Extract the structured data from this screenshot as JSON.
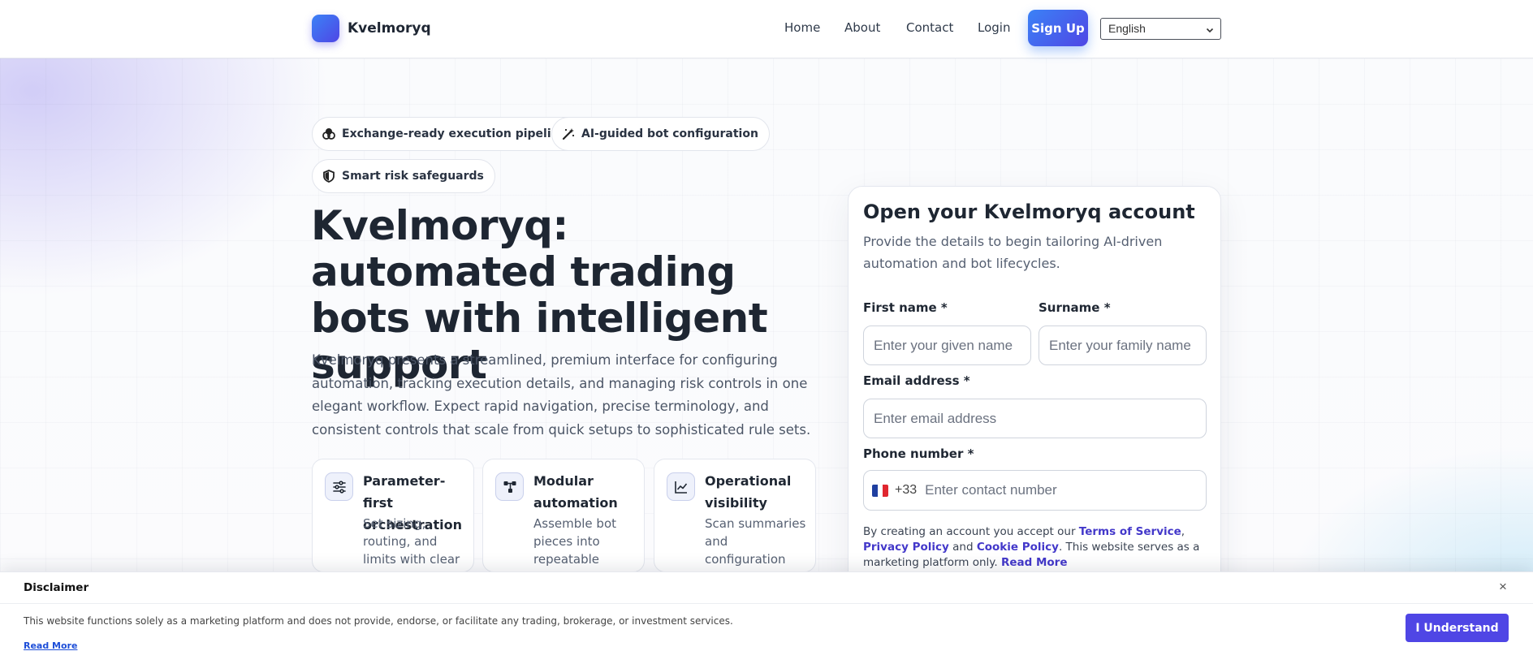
{
  "header": {
    "brand": "Kvelmoryq",
    "nav": [
      "Home",
      "About",
      "Contact",
      "Login"
    ],
    "signup_label": "Sign Up",
    "language": "English"
  },
  "hero": {
    "chips": [
      {
        "label": "Exchange-ready execution pipelines",
        "icon": "coins-icon"
      },
      {
        "label": "AI-guided bot configuration",
        "icon": "magic-wand-icon"
      },
      {
        "label": "Smart risk safeguards",
        "icon": "shield-icon"
      }
    ],
    "title": "Kvelmoryq: automated trading bots with intelligent support",
    "description": "Kvelmoryq presents a streamlined, premium interface for configuring automa­tion, tracking execution details, and managing risk controls in one elegant work­flow. Expect rapid navigation, precise terminology, and consistent controls that scale from quick setups to sophisticated rule sets.",
    "features": [
      {
        "title": "Parameter-first orchestration",
        "desc": "Set sizing, routing, and limits with clear",
        "icon": "sliders-icon"
      },
      {
        "title": "Modular automation",
        "desc": "Assemble bot pieces into repeatable",
        "icon": "nodes-icon"
      },
      {
        "title": "Operational visibility",
        "desc": "Scan summaries and configuration",
        "icon": "chart-line-icon"
      }
    ]
  },
  "form": {
    "title": "Open your Kvelmoryq account",
    "subtitle": "Provide the details to begin tailoring AI-driven automa­tion and bot lifecycles.",
    "first_name_label": "First name *",
    "first_name_placeholder": "Enter your given name",
    "surname_label": "Surname *",
    "surname_placeholder": "Enter your family name",
    "email_label": "Email address *",
    "email_placeholder": "Enter email address",
    "phone_label": "Phone number *",
    "dial_code": "+33",
    "phone_placeholder": "Enter contact number",
    "legal": {
      "prefix": "By creating an account you accept our ",
      "terms": "Terms of Service",
      "comma": ", ",
      "privacy": "Privacy Policy",
      "and": " and ",
      "cookie": "Cookie Policy",
      "suffix": ". This website serves as a marketing plat­form only. ",
      "read_more": "Read More"
    }
  },
  "disclaimer": {
    "title": "Disclaimer",
    "close": "×",
    "text": "This website functions solely as a marketing platform and does not provide, endorse, or facilitate any trading, brokerage, or investment services.",
    "read_more": "Read More",
    "button": "I Understand"
  },
  "colors": {
    "accent": "#4f46e5",
    "accent_blue": "#3b82f6",
    "link": "#4338ca"
  }
}
